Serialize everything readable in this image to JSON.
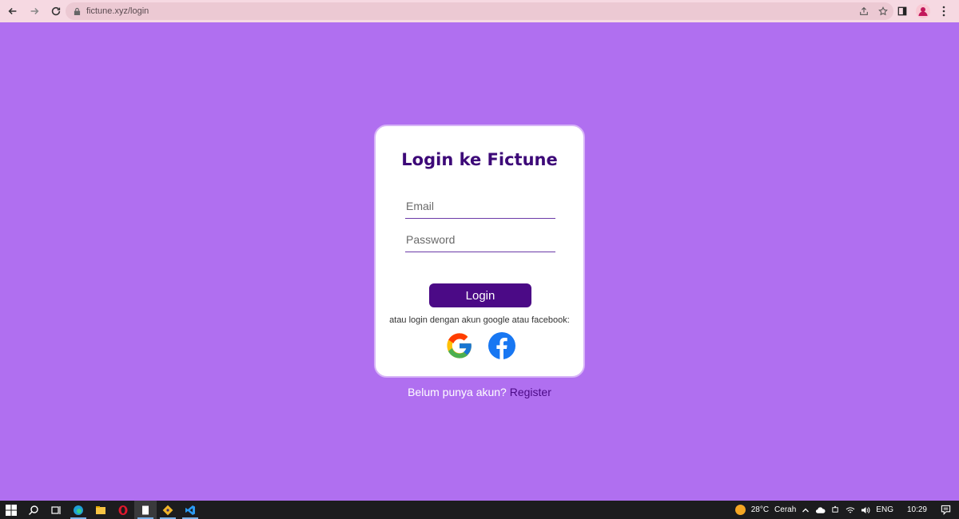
{
  "browser": {
    "url": "fictune.xyz/login"
  },
  "login": {
    "title": "Login ke Fictune",
    "email_placeholder": "Email",
    "password_placeholder": "Password",
    "login_button": "Login",
    "alt_text": "atau login dengan akun google atau facebook:",
    "register_prompt": "Belum punya akun?",
    "register_link": "Register"
  },
  "taskbar": {
    "weather_temp": "28°C",
    "weather_desc": "Cerah",
    "language": "ENG",
    "time": "10:29"
  },
  "colors": {
    "page_background": "#b06ff0",
    "title": "#3d0978",
    "button": "#4b0a86"
  }
}
